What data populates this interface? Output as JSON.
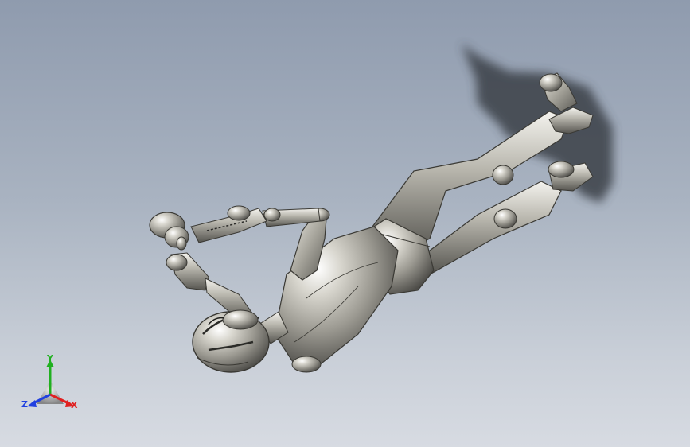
{
  "viewport": {
    "background_top": "#8f9bae",
    "background_bottom": "#d7dbe2"
  },
  "model": {
    "body_color": "#b8b5ac",
    "shadow_color": "#3b3f46"
  },
  "triad": {
    "x_label": "X",
    "y_label": "Y",
    "z_label": "Z",
    "x_color": "#e02020",
    "y_color": "#20b020",
    "z_color": "#2040e0"
  }
}
